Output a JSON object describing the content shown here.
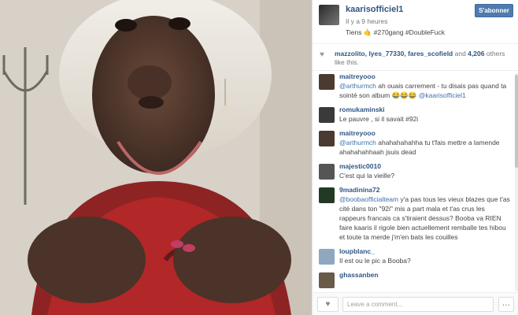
{
  "post": {
    "username": "kaarisofficiel1",
    "time": "Il y a 9 heures",
    "caption": "Tiens 🤙 #270gang #DoubleFuck",
    "follow_label": "S'abonner"
  },
  "likes": {
    "users": "mazzolito, lyes_77330, fares_scofield",
    "mid": " and ",
    "count": "4,206",
    "tail": " others like this."
  },
  "comments": [
    {
      "user": "maitreyooo",
      "mention": "@arthurmch",
      "text": " ah ouais carrement - tu disais pas quand ta sointé son album 😂😂😂 ",
      "mention2": "@kaarisofficiel1",
      "avatar_color": "#4b3a30"
    },
    {
      "user": "romukaminski",
      "mention": "",
      "text": "Le pauvre , si il savait #92i",
      "mention2": "",
      "avatar_color": "#3a3a3a"
    },
    {
      "user": "maitreyooo",
      "mention": "@arthurmch",
      "text": " ahahahahahha tu t'fais mettre a lamende ahahahahhaah jsuis dead",
      "mention2": "",
      "avatar_color": "#4b3a30"
    },
    {
      "user": "majestic0010",
      "mention": "",
      "text": "C'est qui la vieille?",
      "mention2": "",
      "avatar_color": "#555"
    },
    {
      "user": "9madinina72",
      "mention": "@boobaofficialteam",
      "text": " y'a pas tous les vieux blazes que t'as cité dans ton \"92i\" mis a part mala et t'as crus les rappeurs francais ca s'tiraient dessus? Booba va RIEN faire kaaris il rigole bien actuellement remballe tes hibou et toute ta merde j'm'en bats les couilles",
      "mention2": "",
      "avatar_color": "#223a24"
    },
    {
      "user": "loupblanc_",
      "mention": "",
      "text": "Il est ou le pic a Booba?",
      "mention2": "",
      "avatar_color": "#8fa7bf"
    },
    {
      "user": "ghassanben",
      "mention": "",
      "text": "",
      "mention2": "",
      "avatar_color": "#6a5a4a"
    }
  ],
  "footer": {
    "input_placeholder": "Leave a comment...",
    "like_icon": "♥",
    "more_icon": "…"
  },
  "colors": {
    "link": "#2f5685",
    "follow_bg": "#4f7cae"
  }
}
